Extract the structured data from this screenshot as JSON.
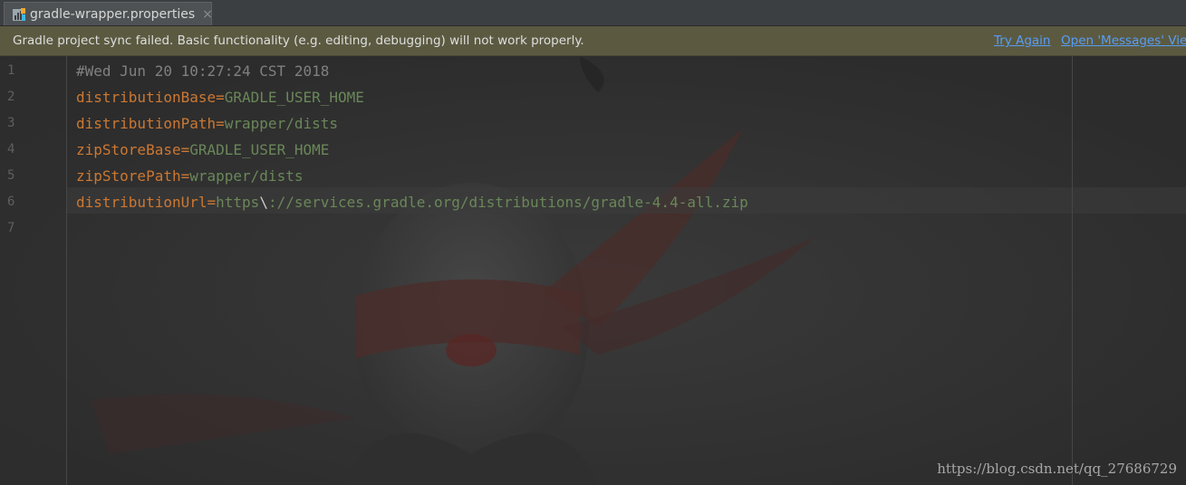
{
  "tab": {
    "filename": "gradle-wrapper.properties",
    "icon": "properties-file-icon",
    "close_glyph": "×"
  },
  "banner": {
    "message": "Gradle project sync failed. Basic functionality (e.g. editing, debugging) will not work properly.",
    "try_again": "Try Again",
    "open_messages": "Open 'Messages' Vie",
    "background_color": "#5b5a41",
    "link_color": "#589df6"
  },
  "editor": {
    "line_numbers": [
      "1",
      "2",
      "3",
      "4",
      "5",
      "6",
      "7"
    ],
    "lines": [
      {
        "comment": "#Wed Jun 20 10:27:24 CST 2018"
      },
      {
        "key": "distributionBase",
        "eq": "=",
        "value": "GRADLE_USER_HOME"
      },
      {
        "key": "distributionPath",
        "eq": "=",
        "value": "wrapper/dists"
      },
      {
        "key": "zipStoreBase",
        "eq": "=",
        "value": "GRADLE_USER_HOME"
      },
      {
        "key": "zipStorePath",
        "eq": "=",
        "value": "wrapper/dists"
      },
      {
        "key": "distributionUrl",
        "eq": "=",
        "value_a": "https",
        "esc": "\\",
        "value_b": "://services.gradle.org/distributions/gradle-4.4-all.zip"
      }
    ],
    "colors": {
      "comment": "#808080",
      "key": "#cc7832",
      "value": "#6a8759"
    }
  },
  "watermark": "https://blog.csdn.net/qq_27686729"
}
